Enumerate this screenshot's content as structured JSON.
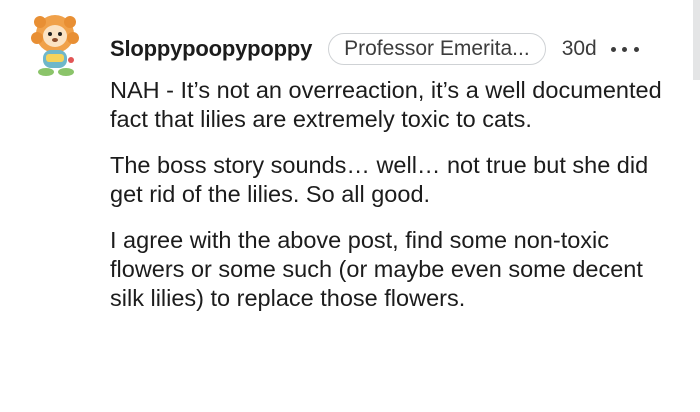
{
  "comment": {
    "username": "Sloppypoopypoppy",
    "flair": "Professor Emerita...",
    "timestamp": "30d",
    "more_icon": "ellipsis-icon",
    "avatar_icon": "snoo-avatar-icon",
    "paragraphs": [
      "NAH - It’s not an overreaction, it’s a well documented fact that lilies are extremely toxic to cats.",
      "The boss story sounds… well… not true but she did get rid of the lilies. So all good.",
      "I agree with the above post, find some non-toxic flowers or some such (or maybe even some decent silk lilies) to replace those flowers."
    ]
  },
  "colors": {
    "text": "#1c1c1c",
    "muted": "#3c3c3c",
    "flair_border": "#cfd2d5",
    "avatar_orange": "#f0a14a"
  }
}
